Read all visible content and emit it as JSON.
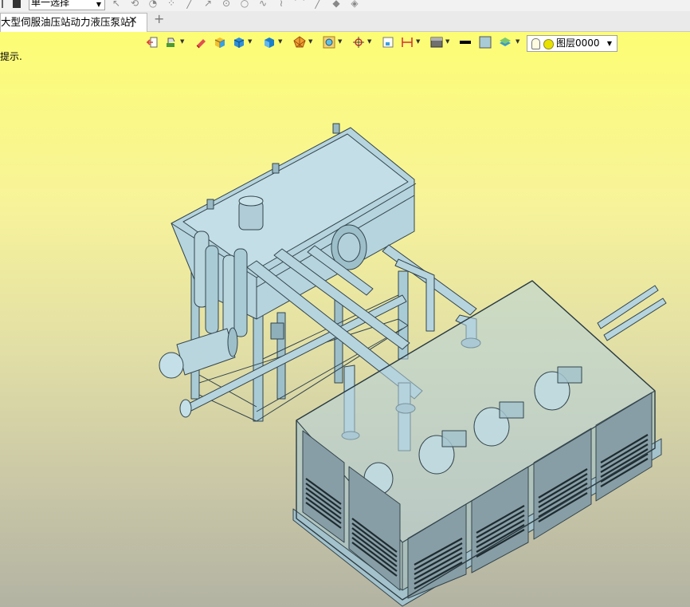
{
  "toolbar": {
    "select_mode": "单一选择",
    "draw_tool_icons": [
      "cursor-icon",
      "transform-icon",
      "rotate-icon",
      "scatter-icon",
      "line-icon",
      "arrow-line-icon",
      "circle-center-icon",
      "circle-icon",
      "spline-icon",
      "wave-icon",
      "arc-icon",
      "pen-icon",
      "shape-icon",
      "layers-icon"
    ]
  },
  "tabs": [
    {
      "label": "大型伺服油压站动力液压泵站]",
      "close": "✕"
    }
  ],
  "new_tab": "+",
  "status_hint": "提示.",
  "view_toolbar": {
    "layer_name": "图层0000",
    "icons": [
      "exit-icon",
      "paint-icon",
      "eraser-icon",
      "box-shaded-icon",
      "cube-icon",
      "cube-blue-icon",
      "net-icon",
      "zoom-icon",
      "pan-icon",
      "fit-icon",
      "dimension-icon",
      "render-mode-icon",
      "line-color-icon",
      "fill-color-icon",
      "layer-stack-icon"
    ]
  },
  "colors": {
    "model_fill": "#a9cbd6",
    "model_line": "#33454c",
    "viewport_top": "#fdfd74",
    "viewport_bottom": "#b3b3a3"
  }
}
